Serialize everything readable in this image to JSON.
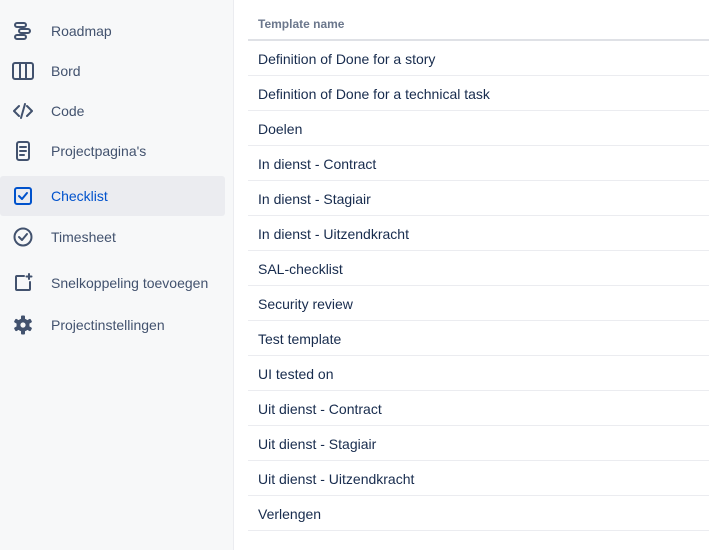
{
  "sidebar": {
    "items": [
      {
        "label": "Roadmap",
        "icon": "roadmap-icon"
      },
      {
        "label": "Bord",
        "icon": "board-icon"
      },
      {
        "label": "Code",
        "icon": "code-icon"
      },
      {
        "label": "Projectpagina's",
        "icon": "pages-icon"
      },
      {
        "label": "Checklist",
        "icon": "checklist-icon",
        "active": true
      },
      {
        "label": "Timesheet",
        "icon": "timesheet-icon"
      },
      {
        "label": "Snelkoppeling toevoegen",
        "icon": "add-shortcut-icon"
      },
      {
        "label": "Projectinstellingen",
        "icon": "settings-gear-icon"
      }
    ]
  },
  "table": {
    "header": "Template name",
    "rows": [
      "Definition of Done for a story",
      "Definition of Done for a technical task",
      "Doelen",
      "In dienst - Contract",
      "In dienst - Stagiair",
      "In dienst - Uitzendkracht",
      "SAL-checklist",
      "Security review",
      "Test template",
      "UI tested on",
      "Uit dienst - Contract",
      "Uit dienst - Stagiair",
      "Uit dienst - Uitzendkracht",
      "Verlengen"
    ]
  },
  "colors": {
    "sidebar_bg": "#f7f8f9",
    "active_bg": "#ebecf0",
    "active_text": "#0052cc",
    "nav_text": "#42526e",
    "text": "#172b4d",
    "header_text": "#6b778c"
  }
}
